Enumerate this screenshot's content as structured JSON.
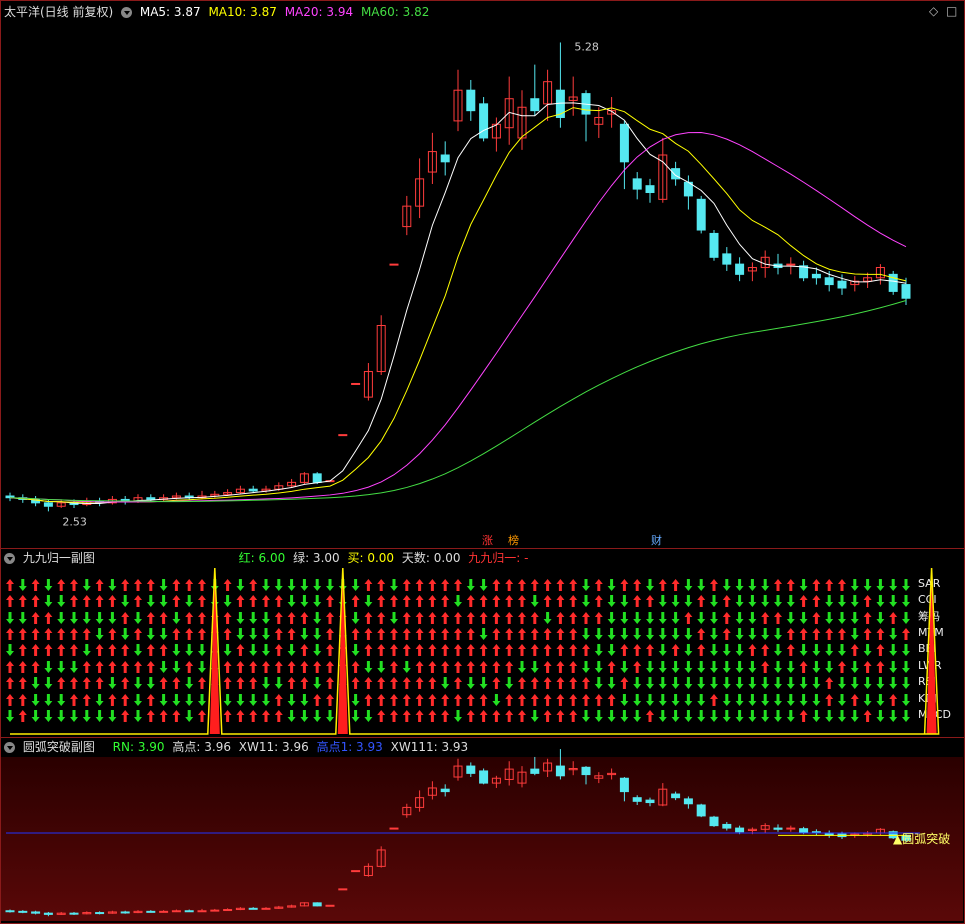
{
  "main_panel": {
    "title": "太平洋(日线 前复权)",
    "indicators": [
      {
        "label": "MA5: 3.87",
        "color": "#ffffff"
      },
      {
        "label": "MA10: 3.87",
        "color": "#ffff00"
      },
      {
        "label": "MA20: 3.94",
        "color": "#ff44ff"
      },
      {
        "label": "MA60: 3.82",
        "color": "#44dd44"
      }
    ],
    "high_label": "5.28",
    "low_label": "2.53",
    "event_tags": [
      {
        "text": "涨",
        "color": "#ff3333"
      },
      {
        "text": "榜",
        "color": "#ff9900"
      },
      {
        "text": "财",
        "color": "#66aaff"
      }
    ],
    "corner_icons": [
      "diamond-icon",
      "square-icon"
    ]
  },
  "panel2": {
    "title": "九九归一副图",
    "stats": [
      {
        "label": "红: 6.00",
        "color": "#33ff33"
      },
      {
        "label": "绿: 3.00",
        "color": "#dddddd"
      },
      {
        "label": "买: 0.00",
        "color": "#ffff00"
      },
      {
        "label": "天数: 0.00",
        "color": "#dddddd"
      },
      {
        "label": "九九归一: -",
        "color": "#ff3333"
      }
    ],
    "row_labels": [
      "SAR",
      "CCI",
      "筹码",
      "MTM",
      "BBI",
      "LWR",
      "RSI",
      "KDJ",
      "MACD"
    ]
  },
  "panel3": {
    "title": "圆弧突破副图",
    "stats": [
      {
        "label": "RN: 3.90",
        "color": "#33ff33"
      },
      {
        "label": "高点: 3.96",
        "color": "#dddddd"
      },
      {
        "label": "XW11: 3.96",
        "color": "#dddddd"
      },
      {
        "label": "高点1: 3.93",
        "color": "#3355ff"
      },
      {
        "label": "XW111: 3.93",
        "color": "#dddddd"
      }
    ],
    "signal_label": "圆弧突破"
  },
  "chart_data": [
    {
      "type": "candlestick",
      "title": "太平洋(日线 前复权)",
      "price_range": [
        2.53,
        5.28
      ],
      "candles": [
        [
          2.62,
          2.61,
          2.64,
          2.59
        ],
        [
          2.61,
          2.6,
          2.63,
          2.58
        ],
        [
          2.6,
          2.58,
          2.62,
          2.56
        ],
        [
          2.58,
          2.56,
          2.6,
          2.53
        ],
        [
          2.56,
          2.58,
          2.6,
          2.55
        ],
        [
          2.58,
          2.57,
          2.6,
          2.55
        ],
        [
          2.57,
          2.59,
          2.61,
          2.56
        ],
        [
          2.59,
          2.58,
          2.61,
          2.56
        ],
        [
          2.58,
          2.6,
          2.62,
          2.57
        ],
        [
          2.6,
          2.59,
          2.62,
          2.57
        ],
        [
          2.59,
          2.61,
          2.63,
          2.58
        ],
        [
          2.61,
          2.6,
          2.63,
          2.59
        ],
        [
          2.6,
          2.61,
          2.63,
          2.59
        ],
        [
          2.61,
          2.62,
          2.64,
          2.6
        ],
        [
          2.62,
          2.61,
          2.64,
          2.6
        ],
        [
          2.61,
          2.62,
          2.65,
          2.6
        ],
        [
          2.62,
          2.63,
          2.65,
          2.61
        ],
        [
          2.63,
          2.64,
          2.66,
          2.62
        ],
        [
          2.64,
          2.66,
          2.68,
          2.63
        ],
        [
          2.66,
          2.65,
          2.68,
          2.64
        ],
        [
          2.65,
          2.66,
          2.68,
          2.64
        ],
        [
          2.66,
          2.68,
          2.7,
          2.65
        ],
        [
          2.68,
          2.7,
          2.72,
          2.67
        ],
        [
          2.7,
          2.75,
          2.76,
          2.69
        ],
        [
          2.75,
          2.7,
          2.76,
          2.69
        ],
        [
          2.71,
          2.71,
          2.71,
          2.71
        ],
        [
          2.98,
          2.98,
          2.98,
          2.98
        ],
        [
          3.28,
          3.28,
          3.28,
          3.28
        ],
        [
          3.2,
          3.35,
          3.4,
          3.18
        ],
        [
          3.35,
          3.62,
          3.68,
          3.33
        ],
        [
          3.98,
          3.98,
          3.98,
          3.98
        ],
        [
          4.2,
          4.32,
          4.38,
          4.15
        ],
        [
          4.32,
          4.48,
          4.6,
          4.25
        ],
        [
          4.52,
          4.64,
          4.75,
          4.45
        ],
        [
          4.62,
          4.58,
          4.7,
          4.5
        ],
        [
          4.82,
          5.0,
          5.12,
          4.76
        ],
        [
          5.0,
          4.88,
          5.06,
          4.82
        ],
        [
          4.92,
          4.72,
          4.96,
          4.7
        ],
        [
          4.72,
          4.8,
          4.84,
          4.64
        ],
        [
          4.78,
          4.95,
          5.08,
          4.68
        ],
        [
          4.72,
          4.9,
          5.0,
          4.65
        ],
        [
          4.95,
          4.88,
          5.15,
          4.85
        ],
        [
          4.92,
          5.05,
          5.12,
          4.82
        ],
        [
          5.0,
          4.84,
          5.28,
          4.78
        ],
        [
          4.94,
          4.96,
          5.08,
          4.85
        ],
        [
          4.98,
          4.86,
          5.0,
          4.7
        ],
        [
          4.8,
          4.84,
          4.9,
          4.72
        ],
        [
          4.86,
          4.88,
          4.96,
          4.78
        ],
        [
          4.8,
          4.58,
          4.82,
          4.42
        ],
        [
          4.48,
          4.42,
          4.52,
          4.36
        ],
        [
          4.44,
          4.4,
          4.48,
          4.34
        ],
        [
          4.36,
          4.62,
          4.72,
          4.34
        ],
        [
          4.54,
          4.48,
          4.58,
          4.44
        ],
        [
          4.46,
          4.38,
          4.5,
          4.3
        ],
        [
          4.36,
          4.18,
          4.38,
          4.16
        ],
        [
          4.16,
          4.02,
          4.18,
          4.0
        ],
        [
          4.04,
          3.98,
          4.08,
          3.94
        ],
        [
          3.98,
          3.92,
          4.02,
          3.88
        ],
        [
          3.94,
          3.96,
          3.99,
          3.88
        ],
        [
          3.96,
          4.02,
          4.06,
          3.9
        ],
        [
          3.98,
          3.96,
          4.04,
          3.92
        ],
        [
          3.98,
          3.98,
          4.02,
          3.92
        ],
        [
          3.97,
          3.9,
          4.0,
          3.88
        ],
        [
          3.92,
          3.9,
          3.96,
          3.86
        ],
        [
          3.9,
          3.86,
          3.94,
          3.82
        ],
        [
          3.88,
          3.84,
          3.92,
          3.8
        ],
        [
          3.86,
          3.88,
          3.91,
          3.82
        ],
        [
          3.88,
          3.9,
          3.93,
          3.84
        ],
        [
          3.9,
          3.96,
          3.98,
          3.86
        ],
        [
          3.92,
          3.82,
          3.94,
          3.8
        ],
        [
          3.86,
          3.78,
          3.9,
          3.74
        ]
      ],
      "ma_lines": [
        "MA5",
        "MA10",
        "MA20",
        "MA60"
      ]
    },
    {
      "type": "heatmap",
      "title": "九九归一副图",
      "rows": [
        "SAR",
        "CCI",
        "筹码",
        "MTM",
        "BBI",
        "LWR",
        "RSI",
        "KDJ",
        "MACD"
      ],
      "signal_days": [
        16,
        26,
        72
      ]
    },
    {
      "type": "candlestick",
      "title": "圆弧突破副图",
      "reference_level": 3.9,
      "signal_label": "圆弧突破"
    }
  ],
  "colors": {
    "up": "#ff3c3c",
    "down": "#55e8f0",
    "ma5": "#ffffff",
    "ma10": "#ffff00",
    "ma20": "#ff44ff",
    "ma60": "#44dd44",
    "frame": "#8a1a1a"
  }
}
